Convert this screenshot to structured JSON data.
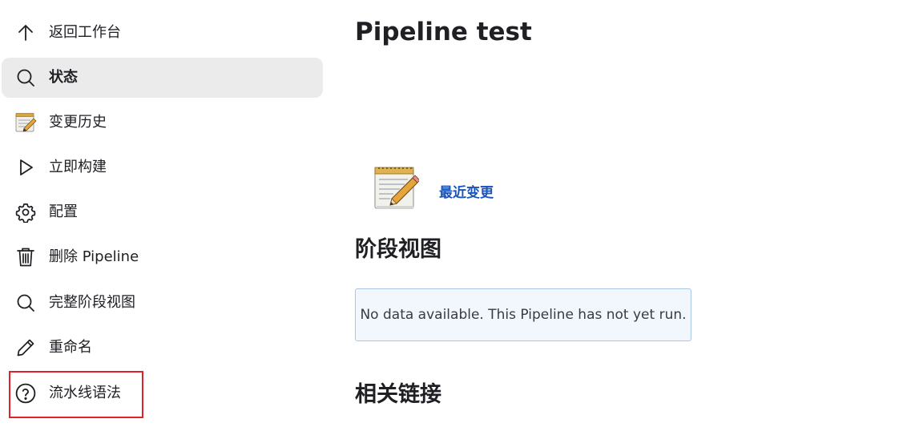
{
  "sidebar": {
    "items": [
      {
        "label": "返回工作台",
        "icon": "arrow-up-icon"
      },
      {
        "label": "状态",
        "icon": "search-icon",
        "active": true
      },
      {
        "label": "变更历史",
        "icon": "notepad-icon"
      },
      {
        "label": "立即构建",
        "icon": "play-icon"
      },
      {
        "label": "配置",
        "icon": "gear-icon"
      },
      {
        "label": "删除 Pipeline",
        "icon": "trash-icon"
      },
      {
        "label": "完整阶段视图",
        "icon": "search-icon"
      },
      {
        "label": "重命名",
        "icon": "pencil-icon"
      },
      {
        "label": "流水线语法",
        "icon": "help-circle-icon",
        "highlighted": true
      }
    ]
  },
  "main": {
    "title": "Pipeline test",
    "recent_changes_label": "最近变更",
    "stage_view_title": "阶段视图",
    "stage_view_empty": "No data available. This Pipeline has not yet run.",
    "related_links_title": "相关链接"
  },
  "colors": {
    "active_bg": "#ebebeb",
    "link": "#1a54b8",
    "highlight_border": "#e0202a",
    "info_bg": "#f1f7fd",
    "info_border": "#a7c6e6"
  }
}
